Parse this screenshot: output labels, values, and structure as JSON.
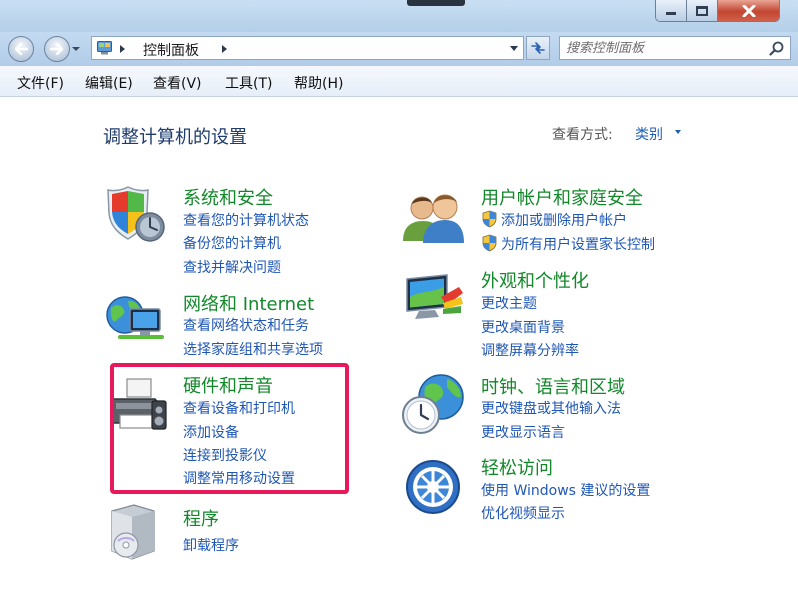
{
  "address": {
    "path_label": "控制面板",
    "search_placeholder": "搜索控制面板"
  },
  "menu": {
    "items": [
      "文件(F)",
      "编辑(E)",
      "查看(V)",
      "工具(T)",
      "帮助(H)"
    ]
  },
  "main": {
    "title": "调整计算机的设置",
    "view_by_label": "查看方式:",
    "view_by_value": "类别"
  },
  "categories": {
    "system_security": {
      "title": "系统和安全",
      "links": [
        "查看您的计算机状态",
        "备份您的计算机",
        "查找并解决问题"
      ]
    },
    "network": {
      "title": "网络和 Internet",
      "links": [
        "查看网络状态和任务",
        "选择家庭组和共享选项"
      ]
    },
    "hardware": {
      "title": "硬件和声音",
      "links": [
        "查看设备和打印机",
        "添加设备",
        "连接到投影仪",
        "调整常用移动设置"
      ]
    },
    "programs": {
      "title": "程序",
      "links": [
        "卸载程序"
      ]
    },
    "user_accounts": {
      "title": "用户帐户和家庭安全",
      "links": [
        "添加或删除用户帐户",
        "为所有用户设置家长控制"
      ]
    },
    "appearance": {
      "title": "外观和个性化",
      "links": [
        "更改主题",
        "更改桌面背景",
        "调整屏幕分辨率"
      ]
    },
    "clock": {
      "title": "时钟、语言和区域",
      "links": [
        "更改键盘或其他输入法",
        "更改显示语言"
      ]
    },
    "ease": {
      "title": "轻松访问",
      "links": [
        "使用 Windows 建议的设置",
        "优化视频显示"
      ]
    }
  },
  "colors": {
    "category_title": "#13882a",
    "link": "#1f57b5",
    "highlight_border": "#e8195a"
  },
  "icons": {
    "system_security": "shield-icon",
    "network": "network-globe-icon",
    "hardware": "printer-icon",
    "programs": "program-box-icon",
    "user_accounts": "users-icon",
    "appearance": "monitor-palette-icon",
    "clock": "globe-clock-icon",
    "ease": "ease-of-access-icon"
  }
}
